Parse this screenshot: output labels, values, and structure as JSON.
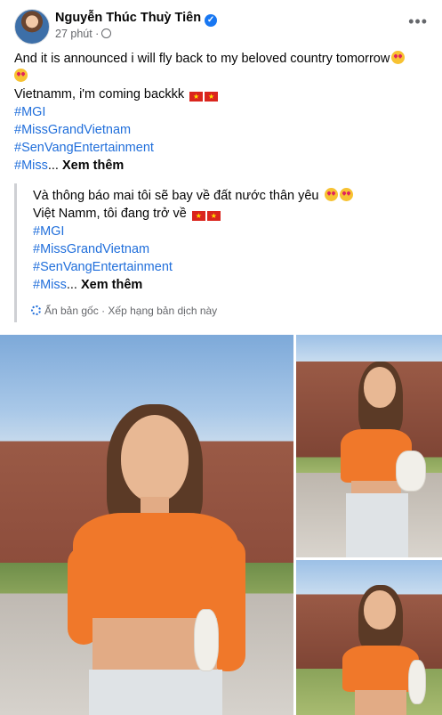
{
  "post": {
    "author": "Nguyễn Thúc Thuỳ Tiên",
    "time": "27 phút ·",
    "more_label": "•••",
    "text_line1": "And it is announced i will fly back to my beloved country tomorrow",
    "text_line3": "Vietnamm, i'm coming backkk",
    "hashtags": [
      "#MGI",
      "#MissGrandVietnam",
      "#SenVangEntertainment",
      "#Miss"
    ],
    "ellipsis": "...",
    "see_more": "Xem thêm"
  },
  "translation": {
    "line1": "Và thông báo mai tôi sẽ bay về đất nước thân yêu",
    "line2": "Việt Namm, tôi đang trở về",
    "hashtags": [
      "#MGI",
      "#MissGrandVietnam",
      "#SenVangEntertainment",
      "#Miss"
    ],
    "ellipsis": "...",
    "see_more": "Xem thêm",
    "hide_original": "Ẩn bản gốc",
    "separator": "·",
    "rate_translation": "Xếp hạng bản dịch này"
  },
  "icons": {
    "verified": "verified-badge-icon",
    "privacy": "globe-icon",
    "emoji": "heart-eyes-emoji-icon",
    "flag": "vietnam-flag-icon",
    "translate": "translate-gear-icon"
  },
  "colors": {
    "hashtag": "#216fdb",
    "verified": "#1877f2",
    "meta_text": "#65676b",
    "sweater": "#f0782a"
  }
}
